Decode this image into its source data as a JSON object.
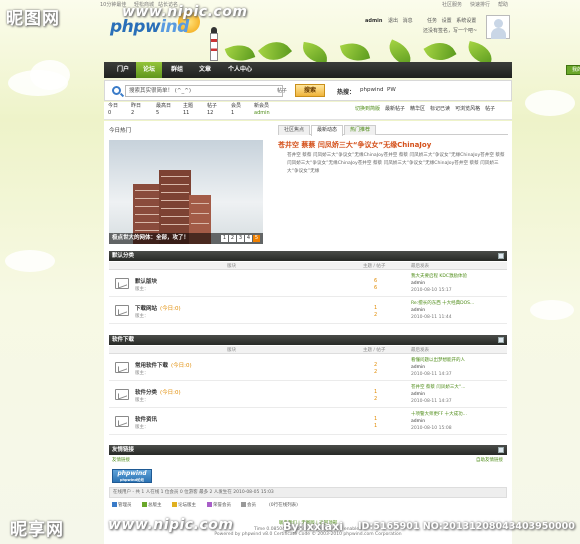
{
  "watermark": {
    "site_left": "昵图网",
    "url_left": "www.nipic.com",
    "site_bottom": "昵享网",
    "url_bottom": "www.nipic.com",
    "credit": "By:lxxiaxi",
    "id_line": "ID:5165901 NO:20131208043403950000"
  },
  "topbar": {
    "left_links": [
      "10分钟最佳",
      "轻松商城",
      "站长访名"
    ],
    "right_links": [
      "社区服务",
      "快速排行",
      "帮助"
    ]
  },
  "logo": {
    "main": "phpw",
    "sub": "ind"
  },
  "user": {
    "name": "admin",
    "links": [
      "退出",
      "消息",
      "任务",
      "设置",
      "系统设置"
    ],
    "welcome": "还没有签名，写一个吧~"
  },
  "nav": {
    "items": [
      "门户",
      "论坛",
      "群组",
      "文章",
      "个人中心"
    ],
    "active_index": 1,
    "right_button": "我的快捷通道"
  },
  "search": {
    "placeholder": "搜索其实很简单！ (^_^)",
    "type_label": "帖子",
    "button": "搜索",
    "hot_label": "热搜：",
    "hot_terms": [
      "phpwind",
      "PW"
    ]
  },
  "stats": {
    "items": [
      {
        "label": "今日",
        "value": "0"
      },
      {
        "label": "昨日",
        "value": "2"
      },
      {
        "label": "最高日",
        "value": "5"
      },
      {
        "label": "主题",
        "value": "11"
      },
      {
        "label": "帖子",
        "value": "12"
      },
      {
        "label": "会员",
        "value": "1"
      },
      {
        "label": "新会员",
        "value": "admin"
      }
    ],
    "sublinks": [
      "切换到简版",
      "最新帖子",
      "精华区",
      "标记已读",
      "可浏览风格",
      "帖子"
    ]
  },
  "hot": {
    "section_title": "今日热门",
    "tabs": [
      "社区焦点",
      "最新动态",
      "热门推荐"
    ],
    "active_tab": 1,
    "headline": "苍井空 蔡蔡 闫凤娇三大“争议女”无缘ChinaJoy",
    "summary": "苍井空 蔡蔡 闫凤娇三大“争议女”无缘ChinaJoy苍井空 蔡蔡 闫凤娇三大“争议女”无缘ChinaJoy苍井空 蔡蔡 闫凤娇三大“争议女”无缘ChinaJoy苍井空 蔡蔡 闫凤娇三大“争议女”无缘ChinaJoy苍井空 蔡蔡 闫凤娇三大“争议女”无缘",
    "photo_caption": "极点世大的网体：全部，攻了！",
    "pages": [
      "1",
      "2",
      "3",
      "4",
      "5"
    ],
    "active_page": 4
  },
  "columns": {
    "name": "版块",
    "topic_post": "主题 / 帖子",
    "last_post": "最后发表"
  },
  "categories": [
    {
      "title": "默认分类",
      "forums": [
        {
          "name": "默认版块",
          "today": "",
          "moderator": "版主：",
          "topics": "6",
          "posts": "6",
          "last_title": "我大夫要启程 KDC激励体验",
          "last_user": "admin",
          "last_date": "2010-08-10 15:17"
        },
        {
          "name": "下载网站",
          "today": "(今日:0)",
          "moderator": "版主：",
          "topics": "1",
          "posts": "2",
          "last_title": "Re:擅长的东西 十大经典DOS...",
          "last_user": "admin",
          "last_date": "2010-08-11 11:44"
        }
      ]
    },
    {
      "title": "软件下载",
      "forums": [
        {
          "name": "常用软件下载",
          "today": "(今日:0)",
          "moderator": "版主：",
          "topics": "2",
          "posts": "2",
          "last_title": "看懂问题以出梦想能开的人",
          "last_user": "admin",
          "last_date": "2010-08-11 14:37"
        },
        {
          "name": "软件分类",
          "today": "(今日:0)",
          "moderator": "版主：",
          "topics": "1",
          "posts": "2",
          "last_title": "苍井空 蔡蔡 闫凤娇三大“...",
          "last_user": "admin",
          "last_date": "2010-08-11 14:37"
        },
        {
          "name": "软件资讯",
          "today": "",
          "moderator": "版主：",
          "topics": "1",
          "posts": "1",
          "last_title": "十项警大师更FF 十大成功...",
          "last_user": "admin",
          "last_date": "2010-08-10 15:08"
        }
      ]
    }
  ],
  "links": {
    "title": "友情链接",
    "apply": "友情链接",
    "manage": "自助友情链接",
    "logo_text": "phpwind",
    "logo_sub": "phpwind论坛"
  },
  "online": {
    "text": "在线用户 - 共 1 人在线 1 位会员 0 位游客 最多 2 人发生在 2010-08-05 15:03"
  },
  "legend": [
    "管理员",
    "总版主",
    "论坛版主",
    "荣誉会员",
    "会员",
    "(0行在线列表)"
  ],
  "footer": {
    "links": [
      "联系我们",
      "无图版",
      "返回顶部"
    ],
    "time": "Time 0.085049 second(s), query:9 Gzip enabled",
    "powered": "Powered by phpwind v8.0 Certificate Code © 2003-2010 phpwind.com Corporation"
  },
  "colors": {
    "accent_green": "#6aa72a",
    "headline_orange": "#d4501a",
    "link_green": "#4e8c17",
    "nav_dark": "#272926"
  }
}
